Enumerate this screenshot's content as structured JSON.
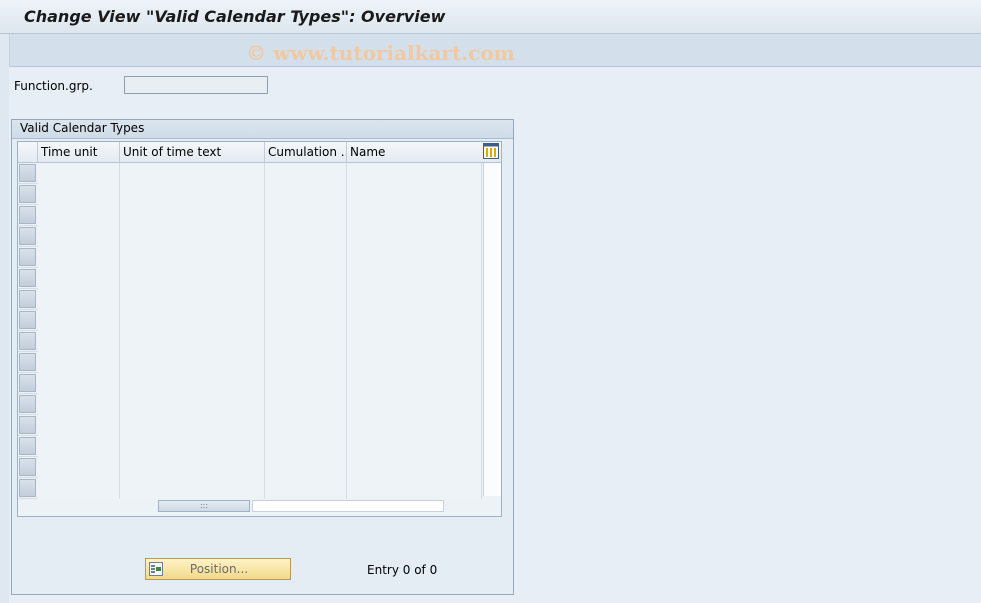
{
  "window": {
    "title": "Change View \"Valid Calendar Types\": Overview"
  },
  "watermark": "© www.tutorialkart.com",
  "form": {
    "function_grp_label": "Function.grp.",
    "function_grp_value": ""
  },
  "group": {
    "title": "Valid Calendar Types"
  },
  "table": {
    "columns": [
      "Time unit",
      "Unit of time text",
      "Cumulation ...",
      "Name"
    ],
    "rows": []
  },
  "footer": {
    "position_button": "Position...",
    "entry_text": "Entry 0 of 0"
  }
}
